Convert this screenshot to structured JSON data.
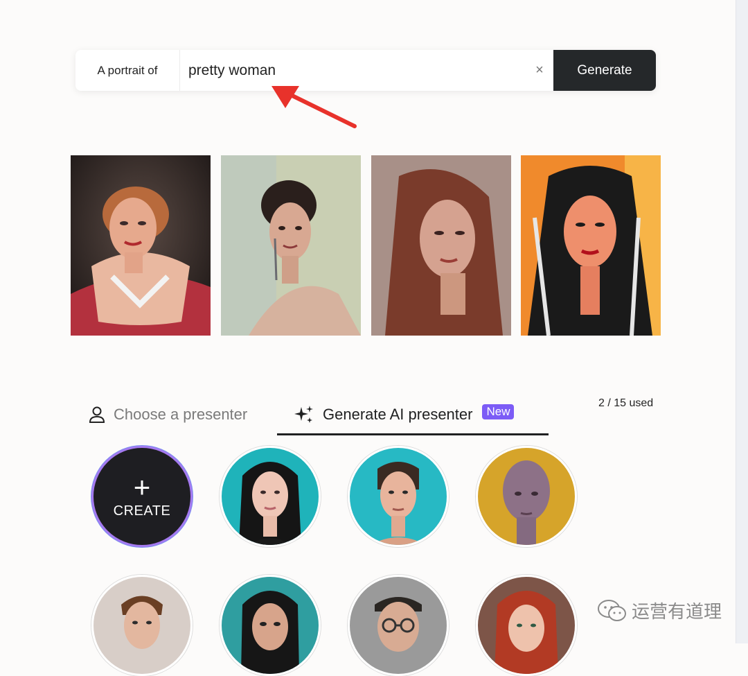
{
  "search": {
    "prefix": "A portrait of",
    "value": "pretty woman",
    "placeholder": "",
    "clear_icon": "×",
    "generate_label": "Generate"
  },
  "results": {
    "portraits": [
      {
        "name": "portrait-result-1",
        "description_icon": "image"
      },
      {
        "name": "portrait-result-2",
        "description_icon": "image"
      },
      {
        "name": "portrait-result-3",
        "description_icon": "image"
      },
      {
        "name": "portrait-result-4",
        "description_icon": "image"
      }
    ]
  },
  "tabs": {
    "choose_label": "Choose a presenter",
    "generate_label": "Generate AI presenter",
    "new_badge": "New",
    "usage": "2 / 15 used"
  },
  "presenters": {
    "create_plus": "+",
    "create_label": "CREATE"
  },
  "watermark": {
    "text": "运营有道理"
  },
  "colors": {
    "accent": "#7c5cf6",
    "generate_button": "#25282a",
    "annotation_arrow": "#e8322b",
    "create_ring": "#a57af0"
  }
}
